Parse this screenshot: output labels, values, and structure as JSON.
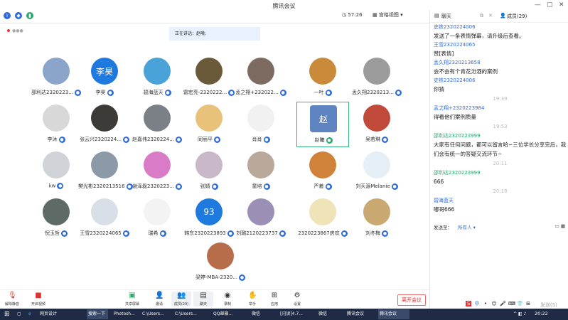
{
  "window": {
    "title": "腾讯会议",
    "timer": "57:26",
    "view_mode": "宫格视图",
    "minimize": "—",
    "maximize": "▢",
    "close": "✕"
  },
  "stage": {
    "speaking_label": "正在讲话：赵曦;",
    "participants": [
      {
        "name": "邵利达2320223...",
        "bg": "#8aa5c9",
        "initial": "",
        "mic": "muted"
      },
      {
        "name": "李昊",
        "bg": "#1f7ae0",
        "initial": "李昊",
        "mic": "muted"
      },
      {
        "name": "碧海蓝天",
        "bg": "#4aa3d8",
        "initial": "",
        "mic": "muted"
      },
      {
        "name": "雷宏亮-2320222...",
        "bg": "#6b5a3a",
        "initial": "",
        "mic": "muted"
      },
      {
        "name": "孟之翔+232022...",
        "bg": "#7d6b62",
        "initial": "",
        "mic": "muted"
      },
      {
        "name": "一叶",
        "bg": "#c98a3a",
        "initial": "",
        "mic": "muted"
      },
      {
        "name": "孟久翔2320213...",
        "bg": "#9b9b9b",
        "initial": "",
        "mic": "muted"
      },
      {
        "name": "李沐",
        "bg": "#d8d8d8",
        "initial": "",
        "mic": "muted"
      },
      {
        "name": "张云兴2320224...",
        "bg": "#3d3b38",
        "initial": "",
        "mic": "muted"
      },
      {
        "name": "赵嘉伟2320224...",
        "bg": "#7b7f86",
        "initial": "",
        "mic": "muted"
      },
      {
        "name": "同丽平",
        "bg": "#e8c27a",
        "initial": "",
        "mic": "muted"
      },
      {
        "name": "肖肖",
        "bg": "#f1f1f1",
        "initial": "",
        "mic": "muted"
      },
      {
        "name": "赵曦",
        "bg": "#5e85c2",
        "initial": "赵",
        "mic": "speaking"
      },
      {
        "name": "吴若琳",
        "bg": "#c24a3a",
        "initial": "",
        "mic": "muted"
      },
      {
        "name": "kw",
        "bg": "#cfd3d8",
        "initial": "",
        "mic": "muted"
      },
      {
        "name": "樊光彬2320213516",
        "bg": "#8c9aa8",
        "initial": "",
        "mic": "muted"
      },
      {
        "name": "谢泽磊2320223...",
        "bg": "#d97bc6",
        "initial": "",
        "mic": "muted"
      },
      {
        "name": "张婧",
        "bg": "#c9b8c8",
        "initial": "",
        "mic": "muted"
      },
      {
        "name": "童培",
        "bg": "#b8a99a",
        "initial": "",
        "mic": "muted"
      },
      {
        "name": "严着",
        "bg": "#d0823a",
        "initial": "",
        "mic": "muted"
      },
      {
        "name": "刘天源Melanie",
        "bg": "#e6eef6",
        "initial": "",
        "mic": "muted"
      },
      {
        "name": "倪玉哲",
        "bg": "#5d6a66",
        "initial": "",
        "mic": "muted"
      },
      {
        "name": "王雪2320224065",
        "bg": "#d9dfe6",
        "initial": "",
        "mic": "muted"
      },
      {
        "name": "瑞希",
        "bg": "#f3f3f3",
        "initial": "",
        "mic": "muted"
      },
      {
        "name": "韩东2320223893",
        "bg": "#1f7ae0",
        "initial": "93",
        "mic": "muted"
      },
      {
        "name": "刘璐2120223737",
        "bg": "#9c8fb5",
        "initial": "",
        "mic": "muted"
      },
      {
        "name": "2320223867房欢",
        "bg": "#efe3b8",
        "initial": "",
        "mic": "muted"
      },
      {
        "name": "刘冬梅",
        "bg": "#c9a872",
        "initial": "",
        "mic": "muted"
      },
      {
        "name": "梁婷-MBA-2320...",
        "bg": "#b86d4a",
        "initial": "",
        "mic": "muted"
      }
    ]
  },
  "toolbar": {
    "unmute": "解除静音",
    "video": "开启视频",
    "share": "共享屏幕",
    "invite": "邀请",
    "members": "成员(29)",
    "chat": "聊天",
    "record": "录制",
    "raise_hand": "举手",
    "apps": "应用",
    "settings": "设置",
    "leave": "离开会议"
  },
  "chat_panel": {
    "tab_chat": "聊天",
    "tab_members": "成员(29)",
    "messages": [
      {
        "type": "msg",
        "sender": "史铁2320224006",
        "text": "发送了一条表情弹幕，请升级后查看。"
      },
      {
        "type": "msg",
        "sender": "王雪2320224065",
        "text": "赞[表情]"
      },
      {
        "type": "msg",
        "sender": "孟久翔2320213658",
        "text": "会不会有个青花汾酒的案例"
      },
      {
        "type": "msg",
        "sender": "史铁2320224006",
        "text": "你猜"
      },
      {
        "type": "time",
        "text": "19:39"
      },
      {
        "type": "msg",
        "sender": "孟之翔+2320223984",
        "text": "得看他们案例质量"
      },
      {
        "type": "time",
        "text": "19:53"
      },
      {
        "type": "msg",
        "sender": "邵利达2320223999",
        "text": "大家有任何问题，都可以留言哈~三位学长分享完后，我们会有统一的答疑交流环节~",
        "green": true
      },
      {
        "type": "time",
        "text": "20:11"
      },
      {
        "type": "msg",
        "sender": "邵利达2320223999",
        "text": "666",
        "green": true
      },
      {
        "type": "time",
        "text": "20:18"
      },
      {
        "type": "msg",
        "sender": "碧海蓝天",
        "text": "嘟哥666"
      }
    ],
    "send_to_label": "发送至：",
    "send_to_value": "所有人",
    "send_button": "发送(S)"
  },
  "taskbar": {
    "items": [
      "网页设计",
      "搜索一下",
      "Photosh...",
      "C:\\Users...",
      "C:\\Users...",
      "QQ邮箱...",
      "微信",
      "[闪读]4.7...",
      "微信",
      "腾讯会议",
      "腾讯会议"
    ],
    "time": "20:22"
  },
  "colors": {
    "accent": "#2d6bd8",
    "chat_green": "#25a86a",
    "speaking_border": "#36b37e",
    "taskbar": "#1f2a44"
  }
}
